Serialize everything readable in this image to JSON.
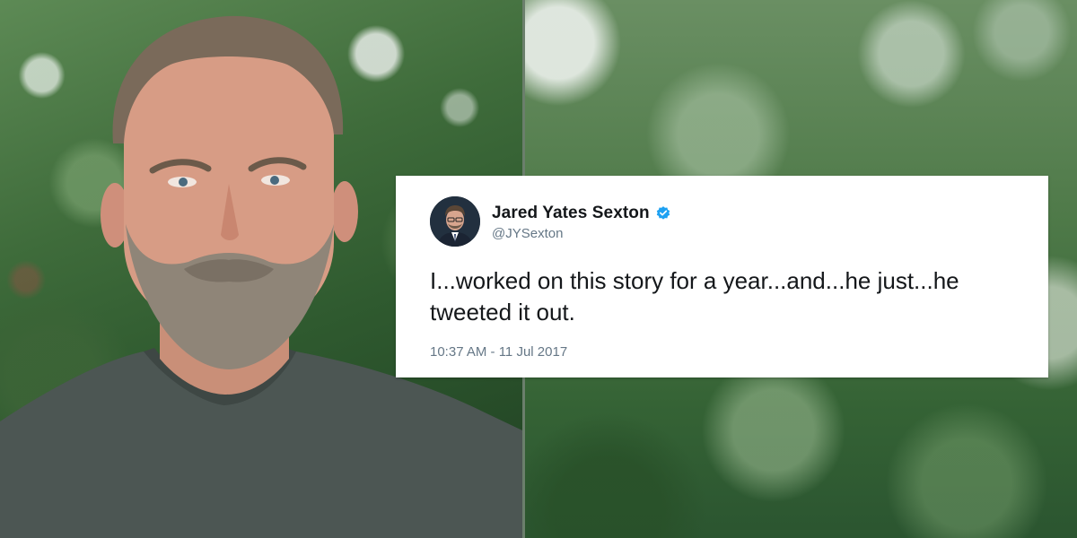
{
  "tweet": {
    "display_name": "Jared Yates Sexton",
    "handle": "@JYSexton",
    "text": "I...worked on this story for a year...and...he just...he tweeted it out.",
    "timestamp": "10:37 AM - 11 Jul 2017",
    "verified_icon": "verified-badge-icon",
    "verified_color": "#1da1f2"
  },
  "colors": {
    "card_bg": "#ffffff",
    "text": "#14171a",
    "muted": "#657786",
    "background_green": "#3f6c3b"
  }
}
